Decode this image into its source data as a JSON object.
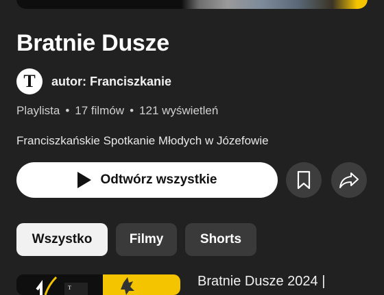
{
  "playlist": {
    "title": "Bratnie Dusze",
    "author_avatar_letter": "T",
    "author": "autor: Franciszkanie",
    "meta": {
      "type": "Playlista",
      "separator": "•",
      "videos": "17 filmów",
      "views": "121 wyświetleń"
    },
    "description": "Franciszkańskie Spotkanie Młodych w Józefowie"
  },
  "actions": {
    "play_all_label": "Odtwórz wszystkie",
    "save_icon": "bookmark-icon",
    "share_icon": "share-icon"
  },
  "filters": [
    {
      "label": "Wszystko",
      "active": true
    },
    {
      "label": "Filmy",
      "active": false
    },
    {
      "label": "Shorts",
      "active": false
    }
  ],
  "videos": [
    {
      "title": "Bratnie Dusze 2024 |"
    }
  ],
  "colors": {
    "background": "#212121",
    "chip": "#3a3a3a",
    "accent_yellow": "#f5c400"
  }
}
